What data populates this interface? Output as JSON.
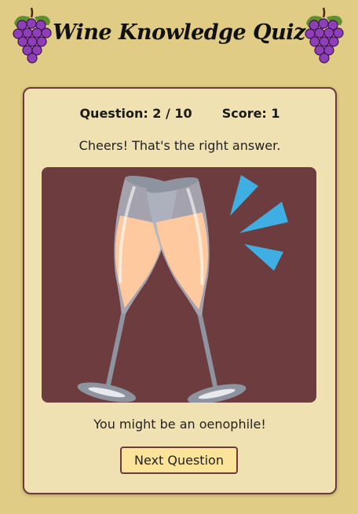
{
  "header": {
    "title": "Wine Knowledge Quiz",
    "left_icon": "grapes-icon",
    "right_icon": "grapes-icon"
  },
  "quiz": {
    "question_label": "Question: 2 / 10",
    "score_label": "Score: 1",
    "feedback": "Cheers! That's the right answer.",
    "result_message": "You might be an oenophile!",
    "next_button_label": "Next Question",
    "image_icon": "clinking-glasses-icon"
  },
  "colors": {
    "background": "#e0cc85",
    "card": "#f0e1b2",
    "card_border": "#6e3a3b",
    "image_panel": "#6d3c3f",
    "button": "#fbe39a",
    "grape": "#8e3fb8",
    "accent_sparkle": "#3faee3"
  }
}
